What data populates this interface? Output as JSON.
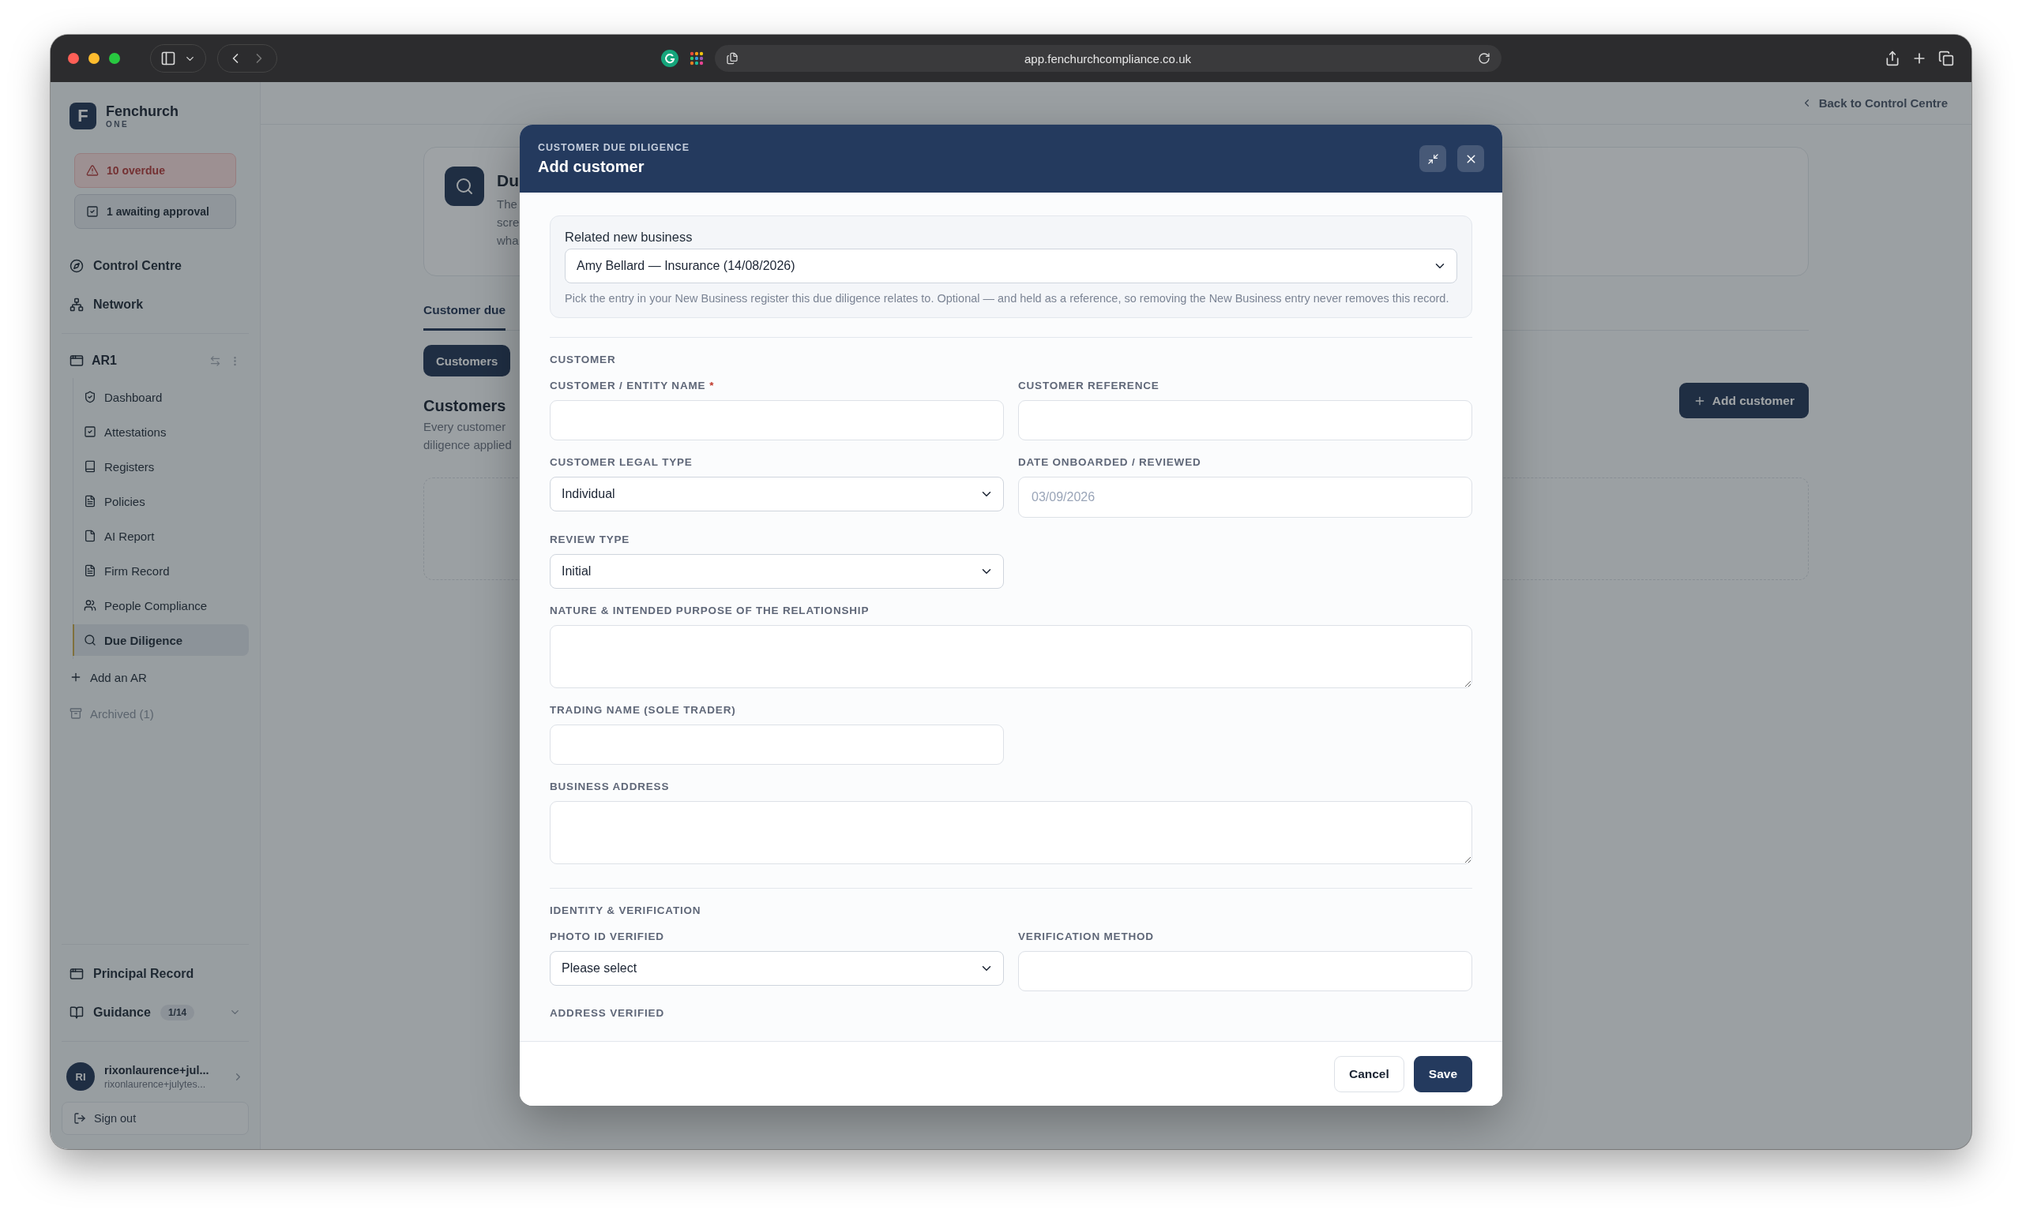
{
  "browser": {
    "url": "app.fenchurchcompliance.co.uk"
  },
  "sidebar": {
    "brand": {
      "logo_letter": "F",
      "name": "Fenchurch",
      "tagline": "ONE"
    },
    "alerts": [
      {
        "kind": "overdue",
        "label": "10 overdue"
      },
      {
        "kind": "approval",
        "label": "1 awaiting approval"
      }
    ],
    "nav": [
      {
        "label": "Control Centre"
      },
      {
        "label": "Network"
      }
    ],
    "workspace": {
      "name": "AR1",
      "items": [
        {
          "label": "Dashboard",
          "selected": false
        },
        {
          "label": "Attestations",
          "selected": false
        },
        {
          "label": "Registers",
          "selected": false
        },
        {
          "label": "Policies",
          "selected": false
        },
        {
          "label": "AI Report",
          "selected": false
        },
        {
          "label": "Firm Record",
          "selected": false
        },
        {
          "label": "People Compliance",
          "selected": false
        },
        {
          "label": "Due Diligence",
          "selected": true
        }
      ]
    },
    "add_ar": "Add an AR",
    "archived": "Archived (1)",
    "bottom_nav": [
      {
        "label": "Principal Record"
      },
      {
        "label": "Guidance",
        "badge": "1/14"
      }
    ],
    "user": {
      "initials": "RI",
      "name": "rixonlaurence+jul...",
      "email": "rixonlaurence+julytes..."
    },
    "sign_out": "Sign out"
  },
  "main": {
    "back_link": "Back to Control Centre",
    "header": {
      "title": "Du",
      "description": [
        "The",
        "scre",
        "wha"
      ]
    },
    "tabs": [
      {
        "label": "Customer due",
        "selected": true
      }
    ],
    "subtabs": [
      {
        "label": "Customers",
        "selected": true
      }
    ],
    "section": {
      "title": "Customers",
      "description": [
        "Every customer",
        "diligence applied"
      ]
    },
    "add_button": "Add customer"
  },
  "modal": {
    "eyebrow": "CUSTOMER DUE DILIGENCE",
    "title": "Add customer",
    "required_mark": "*",
    "related": {
      "label": "Related new business",
      "value": "Amy Bellard — Insurance (14/08/2026)",
      "help": "Pick the entry in your New Business register this due diligence relates to. Optional — and held as a reference, so removing the New Business entry never removes this record."
    },
    "sections": [
      {
        "title": "CUSTOMER",
        "rows": [
          [
            {
              "kind": "text",
              "label": "CUSTOMER / ENTITY NAME",
              "required": true
            },
            {
              "kind": "text",
              "label": "CUSTOMER REFERENCE",
              "required": false
            }
          ],
          [
            {
              "kind": "select",
              "label": "CUSTOMER LEGAL TYPE",
              "required": false,
              "value": "Individual"
            },
            {
              "kind": "date",
              "label": "DATE ONBOARDED / REVIEWED",
              "required": false,
              "value": "03/09/2026"
            }
          ],
          [
            {
              "kind": "select",
              "label": "REVIEW TYPE",
              "required": false,
              "value": "Initial"
            }
          ],
          [
            {
              "kind": "textarea",
              "label": "NATURE & INTENDED PURPOSE OF THE RELATIONSHIP",
              "required": false
            }
          ],
          [
            {
              "kind": "text",
              "label": "TRADING NAME (SOLE TRADER)",
              "required": false
            }
          ],
          [
            {
              "kind": "textarea",
              "label": "BUSINESS ADDRESS",
              "required": false
            }
          ]
        ]
      },
      {
        "title": "IDENTITY & VERIFICATION",
        "rows": [
          [
            {
              "kind": "select",
              "label": "PHOTO ID VERIFIED",
              "required": false,
              "value": "Please select"
            },
            {
              "kind": "text",
              "label": "VERIFICATION METHOD",
              "required": false
            }
          ],
          [
            {
              "kind": "label",
              "label": "ADDRESS VERIFIED",
              "required": false
            }
          ]
        ]
      }
    ],
    "buttons": [
      {
        "kind": "secondary",
        "label": "Cancel"
      },
      {
        "kind": "primary",
        "label": "Save"
      }
    ]
  }
}
